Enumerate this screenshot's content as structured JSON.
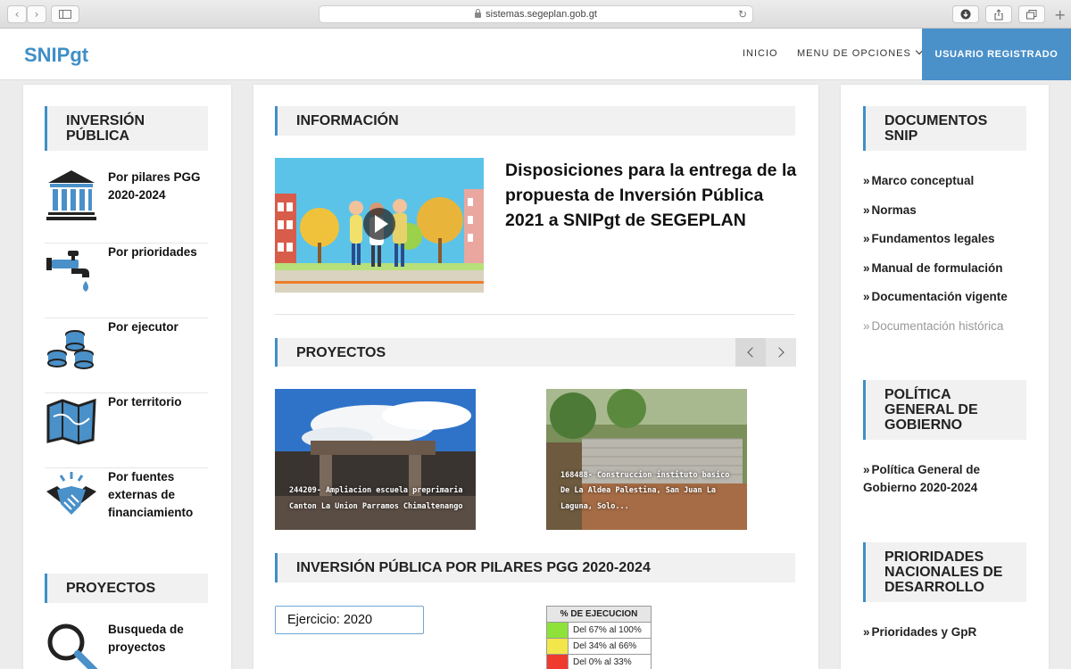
{
  "browser": {
    "url": "sistemas.segeplan.gob.gt"
  },
  "header": {
    "logo": "SNIPgt",
    "nav": [
      {
        "label": "INICIO"
      },
      {
        "label": "MENU DE OPCIONES"
      }
    ],
    "user_button": "USUARIO REGISTRADO"
  },
  "left": {
    "inversion_title": "INVERSIÓN PÚBLICA",
    "items": [
      {
        "label": "Por pilares PGG 2020-2024",
        "icon": "government-building-icon"
      },
      {
        "label": "Por prioridades",
        "icon": "water-tap-icon"
      },
      {
        "label": "Por ejecutor",
        "icon": "coin-stacks-icon"
      },
      {
        "label": "Por territorio",
        "icon": "map-icon"
      },
      {
        "label": "Por fuentes externas de financiamiento",
        "icon": "handshake-icon"
      }
    ],
    "proyectos_title": "PROYECTOS",
    "busqueda_label": "Busqueda de proyectos"
  },
  "center": {
    "info_title": "INFORMACIÓN",
    "headline": "Disposiciones para la entrega de la propuesta de Inversión Pública 2021 a SNIPgt de SEGEPLAN",
    "proyectos_title": "PROYECTOS",
    "projects": [
      {
        "caption": "244209- Ampliacion escuela preprimaria Canton La Union Parramos Chimaltenango"
      },
      {
        "caption": "168488- Construccion instituto basico De La Aldea Palestina, San Juan La Laguna, Solo..."
      }
    ],
    "pilares_title": "INVERSIÓN PÚBLICA POR PILARES PGG 2020-2024",
    "ejercicio": "Ejercicio: 2020",
    "legend": {
      "title": "% DE EJECUCION",
      "rows": [
        {
          "label": "Del 67% al 100%",
          "color": "#8ee23a"
        },
        {
          "label": "Del 34% al 66%",
          "color": "#f2e64a"
        },
        {
          "label": "Del 0% al 33%",
          "color": "#ee3b2e"
        }
      ]
    }
  },
  "right": {
    "docs_title": "DOCUMENTOS SNIP",
    "docs_links": [
      {
        "label": "Marco conceptual"
      },
      {
        "label": "Normas"
      },
      {
        "label": "Fundamentos legales"
      },
      {
        "label": "Manual de formulación"
      },
      {
        "label": "Documentación vigente"
      },
      {
        "label": "Documentación histórica"
      }
    ],
    "pgg_title": "POLÍTICA GENERAL DE GOBIERNO",
    "pgg_link": "Política General de Gobierno 2020-2024",
    "prio_title": "PRIORIDADES NACIONALES DE DESARROLLO",
    "prio_link": "Prioridades y GpR",
    "link_marker": "»"
  }
}
